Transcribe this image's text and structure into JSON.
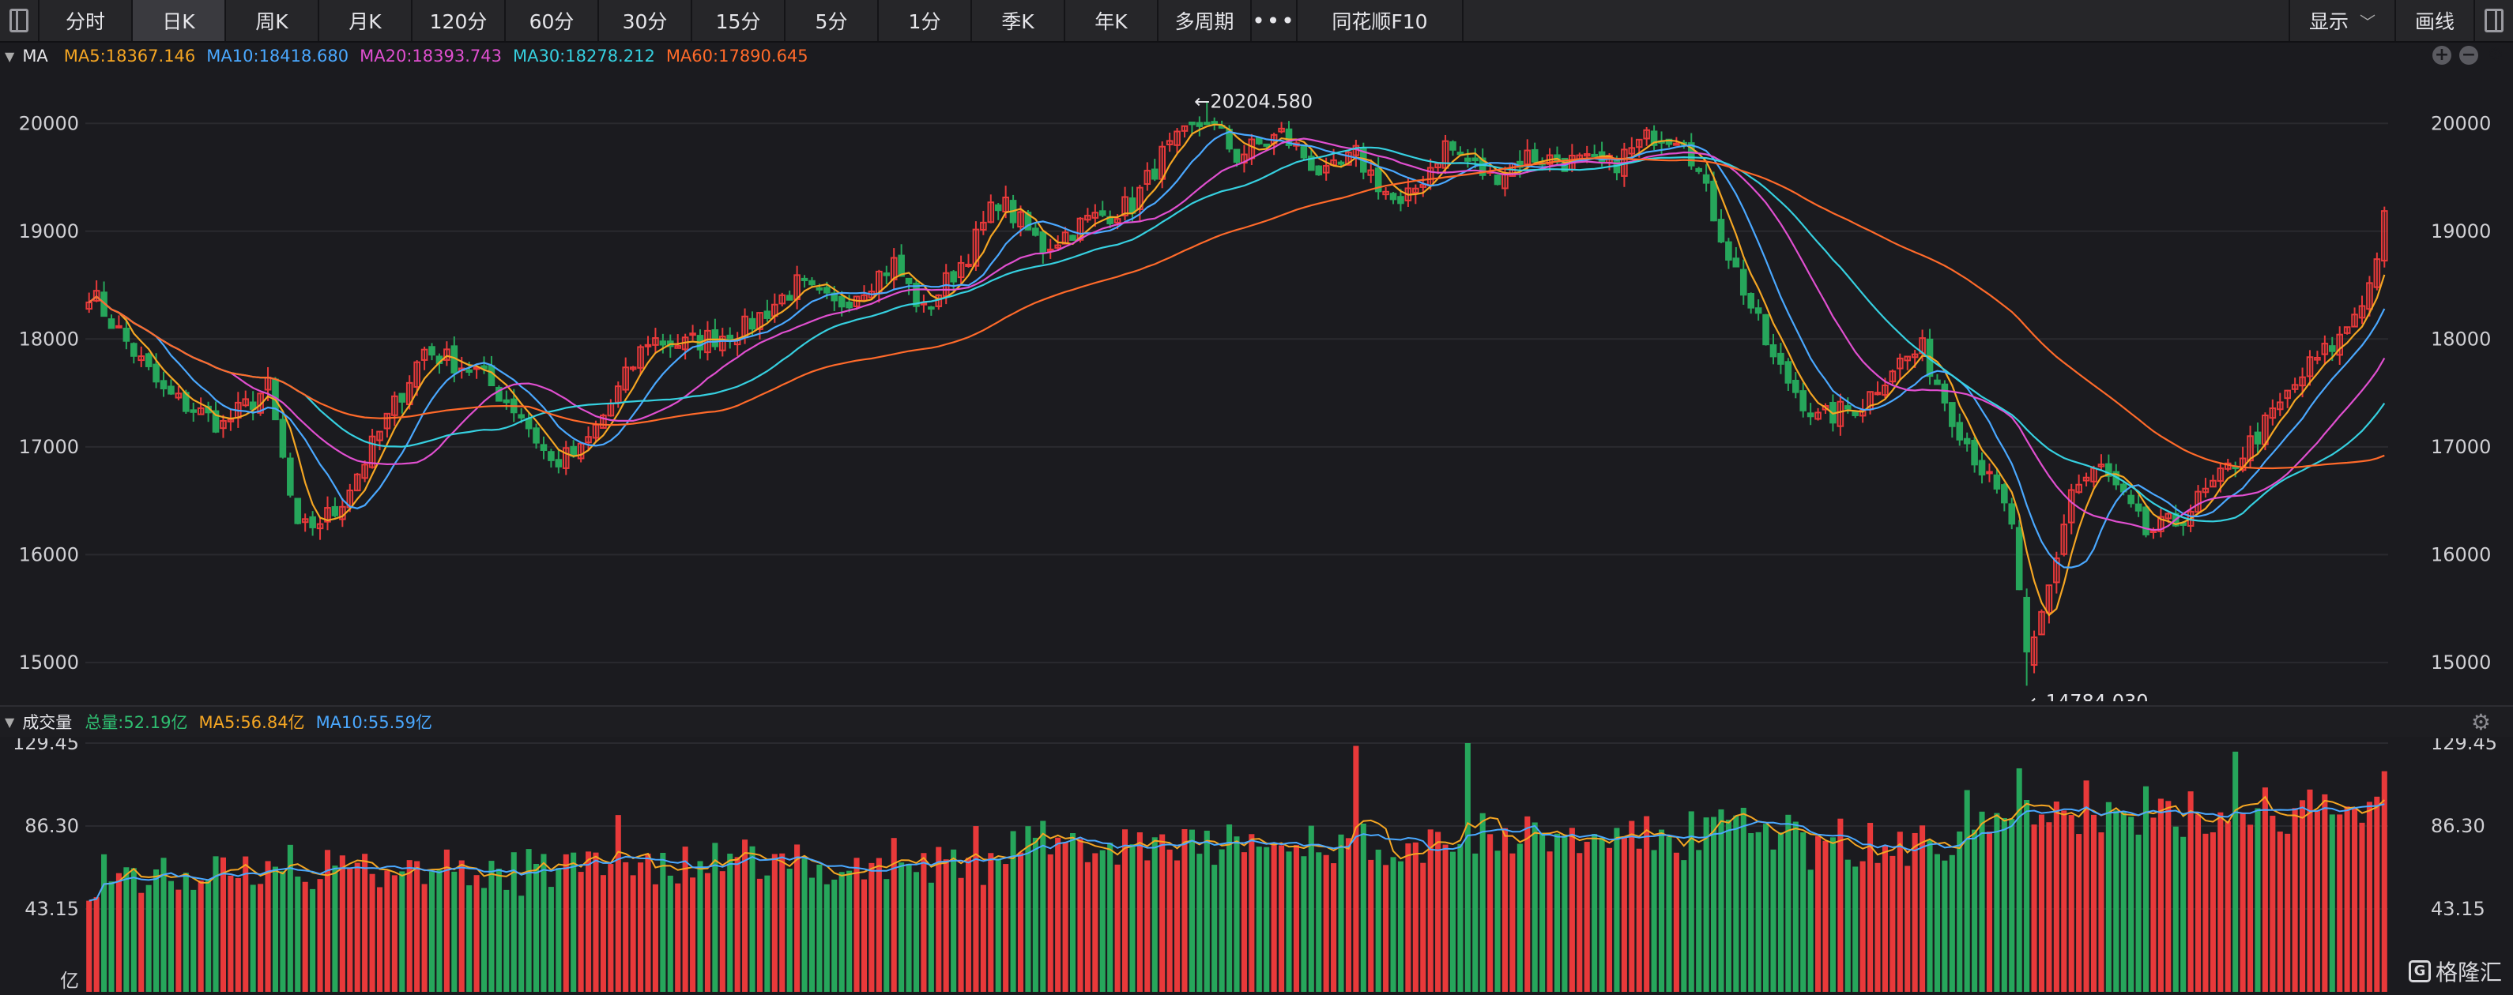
{
  "toolbar": {
    "tabs": [
      "分时",
      "日K",
      "周K",
      "月K",
      "120分",
      "60分",
      "30分",
      "15分",
      "5分",
      "1分",
      "季K",
      "年K",
      "多周期"
    ],
    "active_index": 1,
    "more_label": "•••",
    "f10_label": "同花顺F10",
    "display_label": "显示",
    "draw_label": "画线"
  },
  "ma_legend": {
    "label": "MA",
    "items": [
      {
        "text": "MA5:18367.146",
        "color": "#f5a623"
      },
      {
        "text": "MA10:18418.680",
        "color": "#4aa8ff"
      },
      {
        "text": "MA20:18393.743",
        "color": "#e04fd0"
      },
      {
        "text": "MA30:18278.212",
        "color": "#36d0e0"
      },
      {
        "text": "MA60:17890.645",
        "color": "#ff6a2a"
      }
    ]
  },
  "volume_legend": {
    "label": "成交量",
    "items": [
      {
        "text": "总量:52.19亿",
        "color": "#2fbf71"
      },
      {
        "text": "MA5:56.84亿",
        "color": "#f5a623"
      },
      {
        "text": "MA10:55.59亿",
        "color": "#4aa8ff"
      }
    ]
  },
  "watermark": {
    "text": "格隆汇"
  },
  "colors": {
    "up": "#e8393a",
    "down": "#26a65b",
    "bg": "#1b1b1f",
    "grid": "#2a2a2f",
    "axis_text": "#d0d0d4"
  },
  "chart_data": [
    {
      "type": "candlestick",
      "ylim": [
        14640,
        20500
      ],
      "y_ticks": [
        15000,
        16000,
        17000,
        18000,
        19000,
        20000
      ],
      "y_tick_labels": [
        "15000",
        "16000",
        "17000",
        "18000",
        "19000",
        "20000"
      ],
      "annotations": [
        {
          "text": "←20204.580",
          "value": 20204.58
        },
        {
          "text": "←14784.030",
          "value": 14784.03
        }
      ],
      "high": 20204.58,
      "low": 14784.03,
      "ma_last": {
        "MA5": 18367.146,
        "MA10": 18418.68,
        "MA20": 18393.743,
        "MA30": 18278.212,
        "MA60": 17890.645
      },
      "anchors": [
        [
          0,
          18450
        ],
        [
          10,
          17500
        ],
        [
          18,
          17200
        ],
        [
          24,
          17550
        ],
        [
          28,
          16200
        ],
        [
          33,
          16400
        ],
        [
          38,
          17000
        ],
        [
          45,
          17900
        ],
        [
          52,
          17700
        ],
        [
          58,
          17300
        ],
        [
          62,
          16850
        ],
        [
          66,
          16950
        ],
        [
          70,
          17400
        ],
        [
          75,
          18000
        ],
        [
          80,
          17950
        ],
        [
          88,
          18100
        ],
        [
          95,
          18500
        ],
        [
          100,
          18300
        ],
        [
          108,
          18700
        ],
        [
          112,
          18250
        ],
        [
          118,
          18800
        ],
        [
          122,
          19300
        ],
        [
          128,
          18850
        ],
        [
          134,
          19100
        ],
        [
          140,
          19250
        ],
        [
          144,
          19700
        ],
        [
          150,
          20050
        ],
        [
          154,
          19700
        ],
        [
          160,
          19900
        ],
        [
          166,
          19500
        ],
        [
          170,
          19700
        ],
        [
          176,
          19200
        ],
        [
          182,
          19800
        ],
        [
          188,
          19500
        ],
        [
          193,
          19700
        ],
        [
          198,
          19650
        ],
        [
          204,
          19600
        ],
        [
          210,
          19900
        ],
        [
          214,
          19900
        ],
        [
          220,
          18800
        ],
        [
          226,
          17800
        ],
        [
          232,
          17250
        ],
        [
          238,
          17400
        ],
        [
          242,
          17750
        ],
        [
          246,
          17900
        ],
        [
          250,
          17300
        ],
        [
          254,
          16800
        ],
        [
          258,
          16300
        ],
        [
          260,
          14900
        ],
        [
          263,
          15700
        ],
        [
          266,
          16600
        ],
        [
          270,
          16800
        ],
        [
          276,
          16200
        ],
        [
          280,
          16300
        ],
        [
          286,
          16700
        ],
        [
          292,
          17200
        ],
        [
          298,
          17750
        ],
        [
          302,
          18000
        ],
        [
          306,
          18500
        ],
        [
          308,
          19100
        ]
      ],
      "n": 309
    },
    {
      "type": "bar",
      "ylim": [
        0,
        129.45
      ],
      "y_ticks": [
        43.15,
        86.3,
        129.45
      ],
      "y_tick_labels": [
        "43.15",
        "86.30",
        "129.45"
      ],
      "unit_label": "亿",
      "total_last": 52.19
    }
  ]
}
